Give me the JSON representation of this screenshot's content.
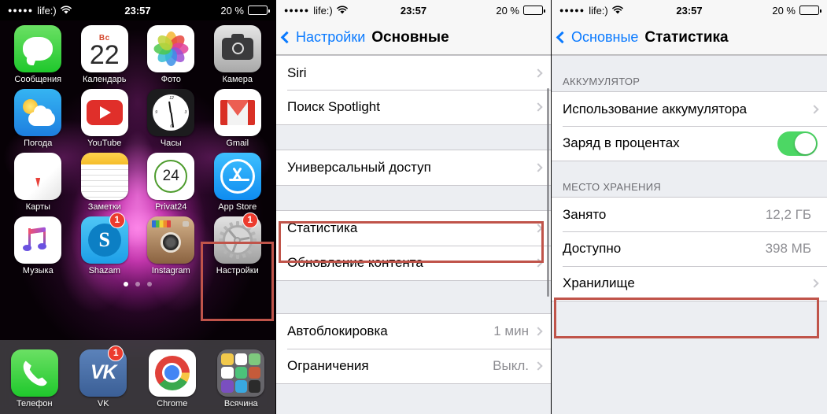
{
  "status_bar": {
    "signal_dots": "●●●●●",
    "carrier": "life:)",
    "wifi_icon": "wifi-icon",
    "time": "23:57",
    "battery_percent": "20 %",
    "battery_level": 20,
    "battery_color": "#e8453c"
  },
  "home_screen": {
    "rows": [
      [
        {
          "label": "Сообщения",
          "icon": "messages-icon",
          "badge": null
        },
        {
          "label": "Календарь",
          "icon": "calendar-icon",
          "badge": null,
          "day_of_week": "Вс",
          "day": "22"
        },
        {
          "label": "Фото",
          "icon": "photos-icon",
          "badge": null
        },
        {
          "label": "Камера",
          "icon": "camera-icon",
          "badge": null
        }
      ],
      [
        {
          "label": "Погода",
          "icon": "weather-icon",
          "badge": null
        },
        {
          "label": "YouTube",
          "icon": "youtube-icon",
          "badge": null
        },
        {
          "label": "Часы",
          "icon": "clock-icon",
          "badge": null
        },
        {
          "label": "Gmail",
          "icon": "gmail-icon",
          "badge": null
        }
      ],
      [
        {
          "label": "Карты",
          "icon": "maps-icon",
          "badge": null
        },
        {
          "label": "Заметки",
          "icon": "notes-icon",
          "badge": null
        },
        {
          "label": "Privat24",
          "icon": "privat24-icon",
          "badge": null,
          "day": "24"
        },
        {
          "label": "App Store",
          "icon": "app-store-icon",
          "badge": null
        }
      ],
      [
        {
          "label": "Музыка",
          "icon": "music-icon",
          "badge": null
        },
        {
          "label": "Shazam",
          "icon": "shazam-icon",
          "badge": "1"
        },
        {
          "label": "Instagram",
          "icon": "instagram-icon",
          "badge": null
        },
        {
          "label": "Настройки",
          "icon": "settings-gear-icon",
          "badge": "1",
          "highlighted": true
        }
      ]
    ],
    "page_dots": {
      "count": 3,
      "active_index": 0
    },
    "dock": [
      {
        "label": "Телефон",
        "icon": "phone-icon",
        "badge": null
      },
      {
        "label": "VK",
        "icon": "vk-icon",
        "badge": "1"
      },
      {
        "label": "Chrome",
        "icon": "chrome-icon",
        "badge": null
      },
      {
        "label": "Всячина",
        "icon": "folder-icon",
        "badge": null
      }
    ],
    "highlight_color": "#c0544a"
  },
  "general_panel": {
    "nav": {
      "back_label": "Настройки",
      "title": "Основные",
      "back_icon": "chevron-left-icon"
    },
    "rows": [
      {
        "label": "Siri",
        "value": "",
        "accessory": "chevron-right-icon",
        "highlighted": false
      },
      {
        "label": "Поиск Spotlight",
        "value": "",
        "accessory": "chevron-right-icon",
        "highlighted": false
      },
      {
        "label": "Универсальный доступ",
        "value": "",
        "accessory": "chevron-right-icon",
        "highlighted": false
      },
      {
        "label": "Статистика",
        "value": "",
        "accessory": "chevron-right-icon",
        "highlighted": true
      },
      {
        "label": "Обновление контента",
        "value": "",
        "accessory": "chevron-right-icon",
        "highlighted": false
      },
      {
        "label": "Автоблокировка",
        "value": "1 мин",
        "accessory": "chevron-right-icon",
        "highlighted": false
      },
      {
        "label": "Ограничения",
        "value": "Выкл.",
        "accessory": "chevron-right-icon",
        "highlighted": false
      }
    ]
  },
  "usage_panel": {
    "nav": {
      "back_label": "Основные",
      "title": "Статистика",
      "back_icon": "chevron-left-icon"
    },
    "sections": [
      {
        "header": "АККУМУЛЯТОР",
        "rows": [
          {
            "label": "Использование аккумулятора",
            "value": "",
            "accessory": "chevron-right-icon",
            "highlighted": false
          },
          {
            "label": "Заряд в процентах",
            "value": "",
            "accessory": "toggle-switch",
            "toggle_on": true,
            "highlighted": false
          }
        ]
      },
      {
        "header": "МЕСТО ХРАНЕНИЯ",
        "rows": [
          {
            "label": "Занято",
            "value": "12,2 ГБ",
            "accessory": "none",
            "highlighted": false
          },
          {
            "label": "Доступно",
            "value": "398 МБ",
            "accessory": "none",
            "highlighted": false
          },
          {
            "label": "Хранилище",
            "value": "",
            "accessory": "chevron-right-icon",
            "highlighted": true
          }
        ]
      }
    ]
  }
}
